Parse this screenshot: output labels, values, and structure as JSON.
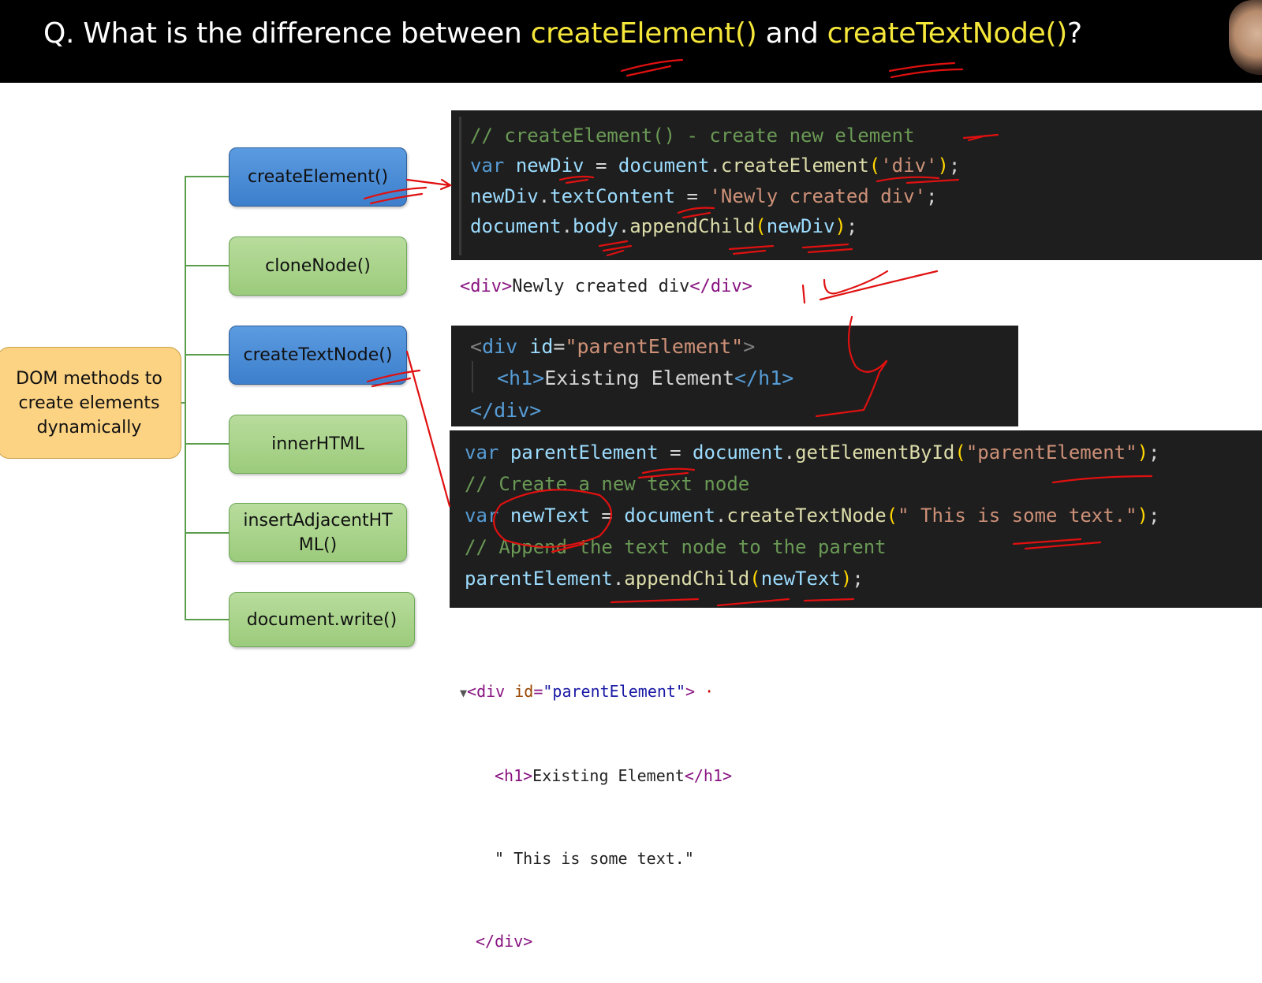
{
  "title": {
    "prefix": "Q. What is the difference between ",
    "term1": "createElement()",
    "middle": " and ",
    "term2": "createTextNode()",
    "suffix": "?"
  },
  "root": {
    "label": "DOM methods to create elements dynamically"
  },
  "methods": [
    {
      "label": "createElement()",
      "color": "blue"
    },
    {
      "label": "cloneNode()",
      "color": "green"
    },
    {
      "label": "createTextNode()",
      "color": "blue"
    },
    {
      "label": "innerHTML",
      "color": "green"
    },
    {
      "label": "insertAdjacentHTML()",
      "color": "green"
    },
    {
      "label": "document.write()",
      "color": "green"
    }
  ],
  "code1": {
    "line1_comment": "// createElement() - create new element",
    "line2": {
      "kw": "var",
      "name": "newDiv",
      "eq": " = ",
      "obj": "document",
      "dot": ".",
      "fn": "createElement",
      "open": "(",
      "arg": "'div'",
      "close": ")",
      "semi": ";"
    },
    "line3": {
      "obj": "newDiv",
      "dot": ".",
      "prop": "textContent",
      "eq": " = ",
      "str": "'Newly created div'",
      "semi": ";"
    },
    "line4": {
      "obj": "document",
      "dot1": ".",
      "prop": "body",
      "dot2": ".",
      "fn": "appendChild",
      "open": "(",
      "arg": "newDiv",
      "close": ")",
      "semi": ";"
    }
  },
  "output1": {
    "open_tag": "<div>",
    "text": "Newly created div",
    "close_tag": "</div>"
  },
  "code2": {
    "line1": {
      "lt": "<",
      "tag": "div",
      "attr": " id",
      "eq": "=",
      "val": "\"parentElement\"",
      "gt": ">"
    },
    "line2": {
      "open": "<h1>",
      "text": "Existing Element",
      "close": "</h1>"
    },
    "line3": {
      "close": "</div>"
    }
  },
  "code3": {
    "line1": {
      "kw": "var",
      "name": "parentElement",
      "eq": " = ",
      "obj": "document",
      "dot": ".",
      "fn": "getElementById",
      "open": "(",
      "arg": "\"parentElement\"",
      "close": ")",
      "semi": ";"
    },
    "line2_comment": "// Create a new text node",
    "line3": {
      "kw": "var",
      "name": "newText",
      "eq": " = ",
      "obj": "document",
      "dot": ".",
      "fn": "createTextNode",
      "open": "(",
      "arg": "\" This is some text.\"",
      "close": ")",
      "semi": ";"
    },
    "line4_comment": "// Append the text node to the parent",
    "line5": {
      "obj": "parentElement",
      "dot": ".",
      "fn": "appendChild",
      "open": "(",
      "arg": "newText",
      "close": ")",
      "semi": ";"
    }
  },
  "output2": {
    "arrow": "▼",
    "line1": {
      "open": "<div",
      "attr": " id",
      "eq": "=",
      "val": "\"parentElement\"",
      "gt": ">",
      "dot": " ·"
    },
    "line2": {
      "open": "<h1>",
      "text": "Existing Element",
      "close": "</h1>"
    },
    "line3": "\" This is some text.\"",
    "line4": "</div>"
  },
  "colors": {
    "title_bg": "#000000",
    "highlight": "#f5e63a",
    "blue_node": "#4a8fd8",
    "green_node": "#a9d48c",
    "root_node": "#fcd283",
    "code_bg": "#1e1e1e",
    "annotation": "#e01010"
  }
}
